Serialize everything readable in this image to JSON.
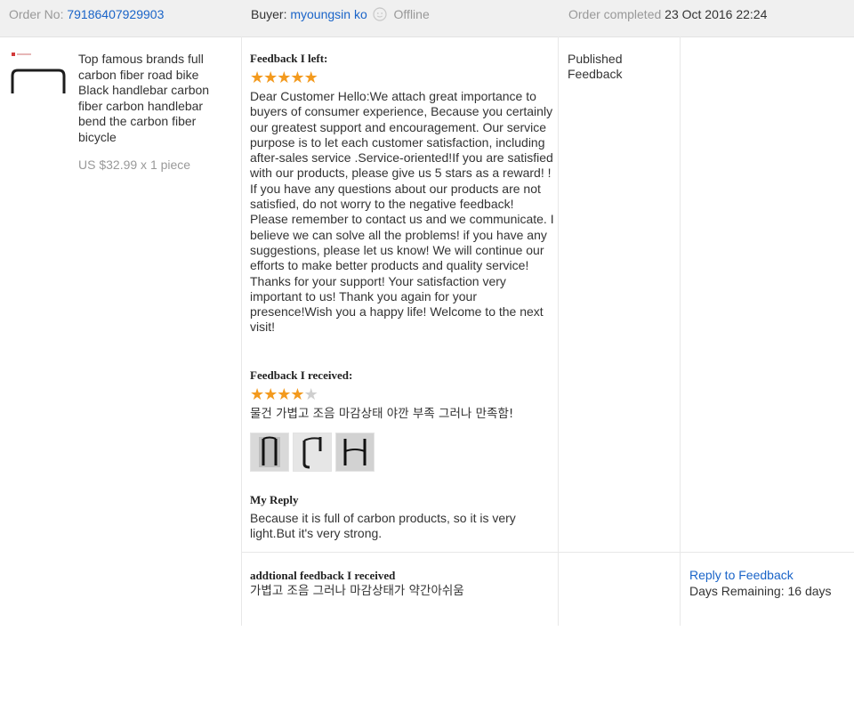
{
  "header": {
    "order_label": "Order No:",
    "order_number": "79186407929903",
    "buyer_label": "Buyer:",
    "buyer_name": "myoungsin ko",
    "buyer_status": "Offline",
    "completed_label": "Order completed",
    "completed_date": "23 Oct 2016 22:24"
  },
  "product": {
    "title": "Top famous brands full carbon fiber road bike Black handlebar carbon fiber carbon handlebar bend the carbon fiber bicycle",
    "price": "US $32.99 x 1 piece"
  },
  "feedback_left": {
    "heading": "Feedback I left:",
    "stars": 5,
    "text": "Dear Customer Hello:We attach great importance to buyers of consumer experience, Because you certainly our greatest support and encouragement. Our service purpose is to let each customer satisfaction, including after-sales service .Service-oriented!If you are satisfied with our products, please give us 5 stars as a reward! ! If you have any questions about our products are not satisfied, do not worry to the negative feedback! Please remember to contact us and we communicate. I believe we can solve all the problems! if you have any suggestions, please let us know! We will continue our efforts to make better products and quality service! Thanks for your support! Your satisfaction very important to us! Thank you again for your presence!Wish you a happy life! Welcome to the next visit!"
  },
  "feedback_received": {
    "heading": "Feedback I received:",
    "stars": 4,
    "max_stars": 5,
    "text": "물건 가볍고 조음 마감상태 야깐 부족 그러나 만족함!",
    "photo_count": 3
  },
  "my_reply": {
    "heading": "My Reply",
    "text": "Because it is full of carbon products, so it is very light.But it's very strong."
  },
  "status": {
    "line1": "Published",
    "line2": "Feedback"
  },
  "additional": {
    "heading": "addtional feedback I received",
    "text": "가볍고 조음 그러나 마감상태가 약간아쉬움",
    "reply_link": "Reply to Feedback",
    "days_remaining": "Days Remaining: 16 days"
  },
  "colors": {
    "link": "#1a64c8",
    "star_on": "#f39a1e",
    "star_off": "#cfcfcf",
    "header_bg": "#f0f0f0"
  }
}
